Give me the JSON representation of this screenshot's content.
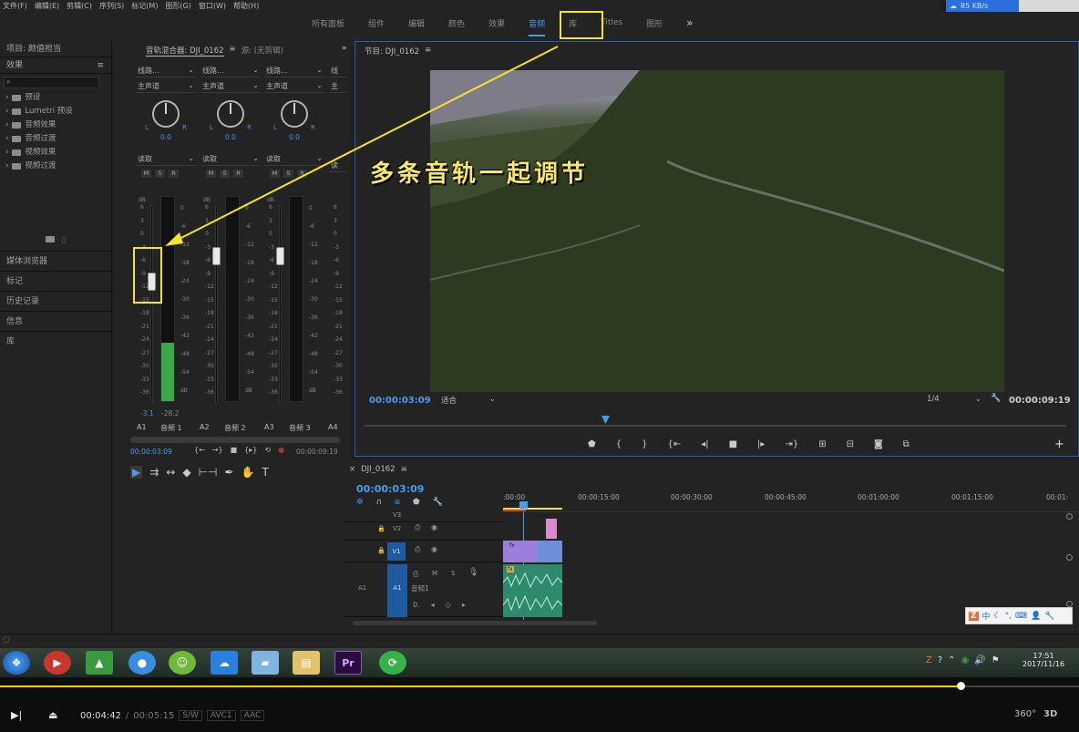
{
  "menu": [
    "文件(F)",
    "编辑(E)",
    "剪辑(C)",
    "序列(S)",
    "标记(M)",
    "图形(G)",
    "窗口(W)",
    "帮助(H)"
  ],
  "workspaces": [
    "所有面板",
    "组件",
    "编辑",
    "颜色",
    "效果",
    "音频",
    "库",
    "Titles",
    "图形"
  ],
  "active_workspace": "音频",
  "more_symbol": "»",
  "net_speed": "85 KB/s",
  "left_panel": {
    "project_tab": "项目: 颜值担当",
    "effects_title": "效果",
    "tree": [
      "预设",
      "Lumetri 预设",
      "音频效果",
      "音频过渡",
      "视频效果",
      "视频过渡"
    ],
    "sections": [
      "媒体浏览器",
      "标记",
      "历史记录",
      "信息",
      "库"
    ]
  },
  "mixer": {
    "tab": "音轨混合器: DJI_0162",
    "source_tab": "源: (无剪辑)",
    "channels": [
      {
        "route": "线路...",
        "out": "主声道",
        "pan": "0.0",
        "auto": "读取",
        "id": "A1",
        "name": "音频 1",
        "val_left": "-3.1",
        "val_right": "-28.2"
      },
      {
        "route": "线路...",
        "out": "主声道",
        "pan": "0.0",
        "auto": "读取",
        "id": "A2",
        "name": "音频 2"
      },
      {
        "route": "线路...",
        "out": "主声道",
        "pan": "0.0",
        "auto": "读取",
        "id": "A3",
        "name": "音频 3"
      },
      {
        "route": "线",
        "out": "主",
        "pan": "",
        "auto": "读",
        "id": "A4",
        "name": ""
      }
    ],
    "msr": [
      "M",
      "S",
      "R"
    ],
    "lr": [
      "L",
      "R"
    ],
    "scale_left": [
      "6",
      "3",
      "0",
      "-3",
      "-6",
      "-9",
      "-12",
      "-15",
      "-18",
      "-21",
      "-24",
      "-27",
      "-30",
      "-33",
      "-36"
    ],
    "scale_right": [
      "0",
      "-6",
      "-12",
      "-18",
      "-24",
      "-30",
      "-36",
      "-42",
      "-48",
      "-54",
      "dB"
    ],
    "db": "dB",
    "tc_left": "00:00:03:09",
    "tc_right": "00:00:09:19"
  },
  "program": {
    "title": "节目: DJI_0162",
    "overlay_text": "多条音轨一起调节",
    "tc_current": "00:00:03:09",
    "fit": "适合",
    "res": "1/4",
    "tc_duration": "00:00:09:19"
  },
  "timeline": {
    "title": "DJI_0162",
    "tc": "00:00:03:09",
    "ruler": [
      ":00:00",
      "00:00:15:00",
      "00:00:30:00",
      "00:00:45:00",
      "00:01:00:00",
      "00:01:15:00",
      "00:01:"
    ],
    "tracks": [
      {
        "id": "V3"
      },
      {
        "id": "V2"
      },
      {
        "id": "V1"
      },
      {
        "id": "A1",
        "name": "音频1"
      }
    ],
    "clip_labels": [
      "fx",
      "fx"
    ]
  },
  "ime": [
    "中"
  ],
  "tray": {
    "time": "17:51",
    "date": "2017/11/16"
  },
  "player": {
    "current": "00:04:42",
    "sep": "/",
    "total": "00:05:15",
    "tags": [
      "S/W",
      "AVC1",
      "AAC"
    ],
    "badge_360": "360°",
    "badge_3d": "3D"
  },
  "colors": {
    "accent": "#4a9cf0",
    "highlight": "#f5e42a",
    "meter_green": "#3aa845"
  }
}
